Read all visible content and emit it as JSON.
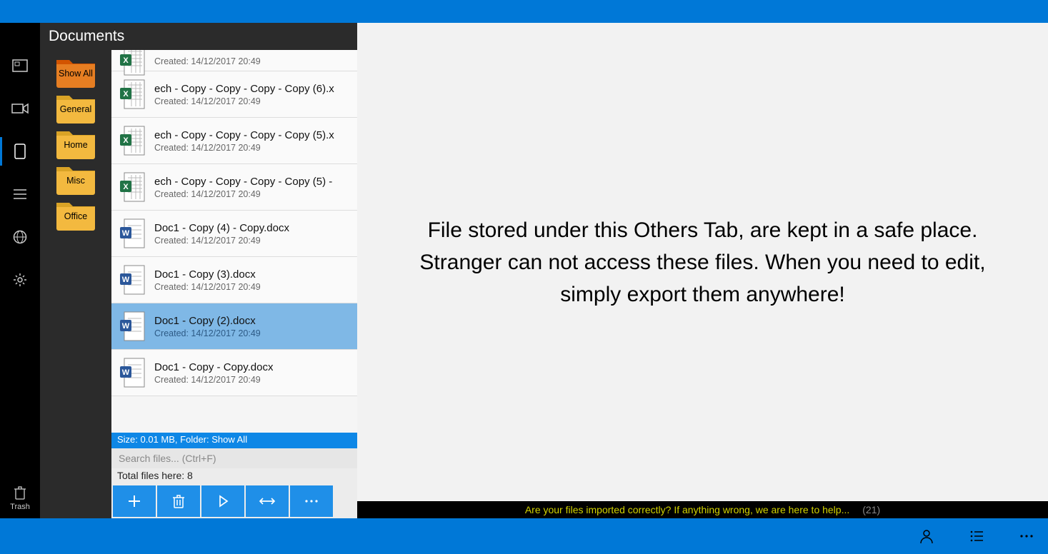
{
  "header": {
    "title": "Documents"
  },
  "rail": {
    "trash_label": "Trash"
  },
  "folders": [
    {
      "label": "Show All",
      "color": "orange",
      "selected": true
    },
    {
      "label": "General",
      "color": "yellow",
      "selected": false
    },
    {
      "label": "Home",
      "color": "yellow",
      "selected": false
    },
    {
      "label": "Misc",
      "color": "yellow",
      "selected": false
    },
    {
      "label": "Office",
      "color": "yellow",
      "selected": false
    }
  ],
  "files": [
    {
      "name": "",
      "created": "Created: 14/12/2017 20:49",
      "type": "excel",
      "selected": false,
      "cut": true
    },
    {
      "name": "ech - Copy - Copy - Copy - Copy (6).x",
      "created": "Created: 14/12/2017 20:49",
      "type": "excel",
      "selected": false
    },
    {
      "name": "ech - Copy - Copy - Copy - Copy (5).x",
      "created": "Created: 14/12/2017 20:49",
      "type": "excel",
      "selected": false
    },
    {
      "name": "ech - Copy - Copy - Copy - Copy (5) -",
      "created": "Created: 14/12/2017 20:49",
      "type": "excel",
      "selected": false
    },
    {
      "name": "Doc1 - Copy (4) - Copy.docx",
      "created": "Created: 14/12/2017 20:49",
      "type": "word",
      "selected": false
    },
    {
      "name": "Doc1 - Copy (3).docx",
      "created": "Created: 14/12/2017 20:49",
      "type": "word",
      "selected": false
    },
    {
      "name": "Doc1 - Copy (2).docx",
      "created": "Created: 14/12/2017 20:49",
      "type": "word",
      "selected": true
    },
    {
      "name": "Doc1 - Copy - Copy.docx",
      "created": "Created: 14/12/2017 20:49",
      "type": "word",
      "selected": false
    }
  ],
  "status": {
    "size_line": "Size: 0.01 MB, Folder: Show All",
    "total_line": "Total files here: 8"
  },
  "search": {
    "placeholder": "Search files... (Ctrl+F)"
  },
  "main": {
    "message": "File stored under this Others Tab, are kept in a safe place. Stranger can not access these files. When you need to edit, simply export them anywhere!"
  },
  "help": {
    "text": "Are your files imported correctly? If anything wrong, we are here to help...",
    "count": "(21)"
  }
}
